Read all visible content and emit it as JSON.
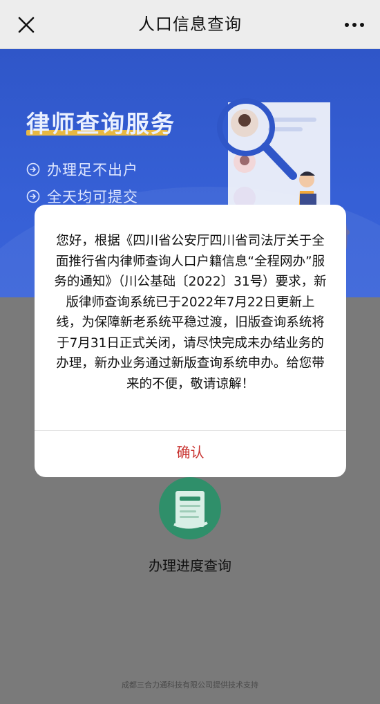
{
  "header": {
    "title": "人口信息查询"
  },
  "banner": {
    "title": "律师查询服务",
    "features": [
      "办理足不出户",
      "全天均可提交"
    ]
  },
  "services": [
    {
      "label": "办理进度查询",
      "icon": "document-progress-icon"
    }
  ],
  "footer": {
    "text": "成都三合力通科技有限公司提供技术支持"
  },
  "dialog": {
    "message": "您好，根据《四川省公安厅四川省司法厅关于全面推行省内律师查询人口户籍信息“全程网办”服务的通知》（川公基础〔2022〕31号）要求，新版律师查询系统已于2022年7月22日更新上线，为保障新老系统平稳过渡，旧版查询系统将于7月31日正式关闭，请尽快完成未办结业务的办理，新办业务通过新版查询系统申办。给您带来的不便，敬请谅解！",
    "confirm_label": "确认"
  },
  "colors": {
    "banner_blue": "#3660d6",
    "accent_gold": "#e7b842",
    "confirm_red": "#c8312e",
    "icon_green": "#2f8f6a"
  }
}
